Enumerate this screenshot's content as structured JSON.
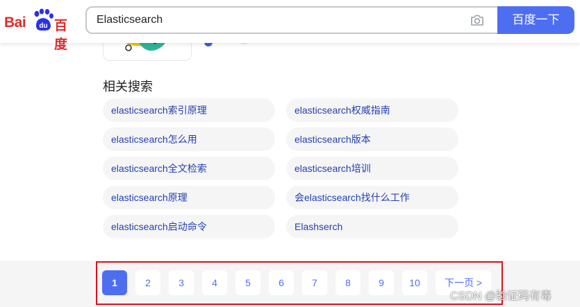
{
  "header": {
    "logo": {
      "bai": "Bai",
      "paw_text": "du",
      "baidu": "百度"
    },
    "search": {
      "value": "Elasticsearch",
      "button_label": "百度一下"
    }
  },
  "related": {
    "title": "相关搜索",
    "items": [
      "elasticsearch索引原理",
      "elasticsearch权威指南",
      "elasticsearch怎么用",
      "elasticsearch版本",
      "elasticsearch全文检索",
      "elasticsearch培训",
      "elasticsearch原理",
      "会elasticsearch找什么工作",
      "elasticsearch启动命令",
      "Elashserch"
    ]
  },
  "pagination": {
    "pages": [
      "1",
      "2",
      "3",
      "4",
      "5",
      "6",
      "7",
      "8",
      "9",
      "10"
    ],
    "current": "1",
    "next_label": "下一页 >"
  },
  "watermark": "CSDN @验证码有毒",
  "colors": {
    "brand_red": "#de2c2c",
    "brand_blue": "#4e6ef2",
    "link_blue": "#2440b3",
    "highlight_red": "#d6121a"
  }
}
